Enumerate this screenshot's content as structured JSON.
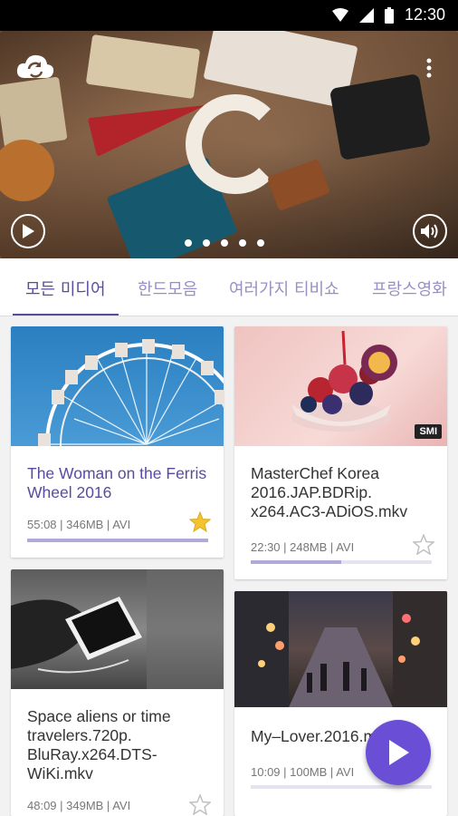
{
  "status": {
    "time": "12:30"
  },
  "hero": {
    "slides_total": 5,
    "active_slide": 1
  },
  "tabs": [
    {
      "label": "모든 미디어"
    },
    {
      "label": "한드모음"
    },
    {
      "label": "여러가지 티비쇼"
    },
    {
      "label": "프랑스영화"
    }
  ],
  "cards": [
    {
      "title": "The Woman on the Ferris Wheel 2016",
      "meta": "55:08 | 346MB | AVI",
      "progress": 1.0,
      "starred": true
    },
    {
      "title": "MasterChef Korea 2016.JAP.BDRip. x264.AC3-ADiOS.mkv",
      "meta": "22:30 | 248MB | AVI",
      "progress": 0.5,
      "starred": false,
      "badge": "SMI"
    },
    {
      "title": "Space aliens or time travelers.720p. BluRay.x264.DTS-WiKi.mkv",
      "meta": "48:09 | 349MB | AVI",
      "progress": 0.0,
      "starred": false
    },
    {
      "title": "My–Lover.2016.mp4",
      "meta": "10:09 | 100MB | AVI",
      "progress": 0.0,
      "starred": false
    }
  ],
  "colors": {
    "accent": "#5a4aa0",
    "fab": "#6b4ed6",
    "star_active": "#f4c430"
  }
}
